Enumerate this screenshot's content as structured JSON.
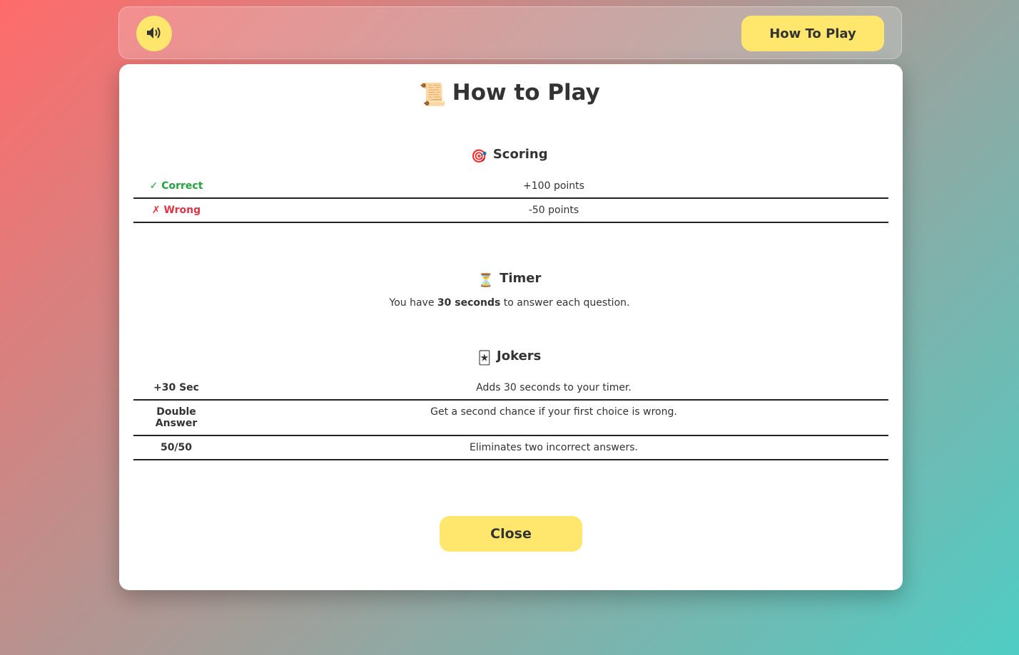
{
  "header": {
    "sound_icon": "speaker-icon",
    "how_to_play_label": "How To Play"
  },
  "modal": {
    "title": "How to Play",
    "title_icon": "📜",
    "scoring": {
      "heading": "Scoring",
      "icon": "🎯",
      "rows": [
        {
          "key_symbol": "✓",
          "key": "Correct",
          "value": "+100 points"
        },
        {
          "key_symbol": "✗",
          "key": "Wrong",
          "value": "-50 points"
        }
      ]
    },
    "timer": {
      "heading": "Timer",
      "icon": "⏳",
      "text_before": "You have ",
      "text_bold": "30 seconds",
      "text_after": " to answer each question."
    },
    "jokers": {
      "heading": "Jokers",
      "icon": "🃏",
      "rows": [
        {
          "key": "+30 Sec",
          "value": "Adds 30 seconds to your timer."
        },
        {
          "key": "Double Answer",
          "value": "Get a second chance if your first choice is wrong."
        },
        {
          "key": "50/50",
          "value": "Eliminates two incorrect answers."
        }
      ]
    },
    "close_label": "Close"
  },
  "colors": {
    "accent": "#ffe66d",
    "correct": "#22a33d",
    "wrong": "#dc3545",
    "bg_start": "#ff6b6b",
    "bg_end": "#4ecdc4"
  }
}
